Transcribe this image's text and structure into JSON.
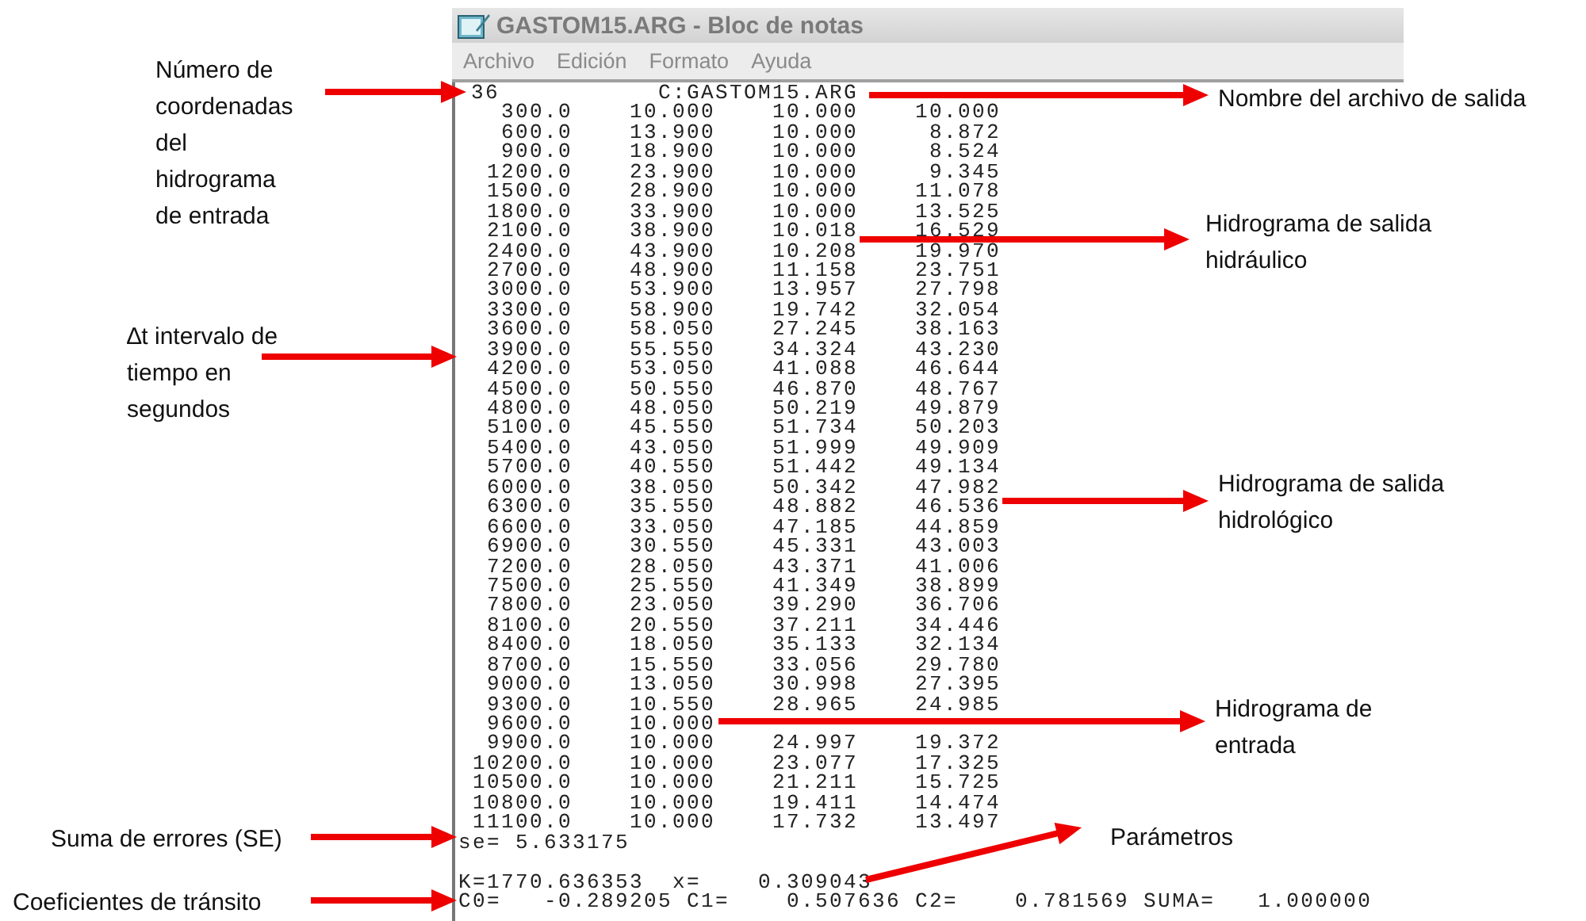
{
  "window": {
    "title": "GASTOM15.ARG - Bloc de notas"
  },
  "menu": [
    "Archivo",
    "Edición",
    "Formato",
    "Ayuda"
  ],
  "document": {
    "header": [
      "36",
      "C:GASTOM15.ARG"
    ],
    "rows": [
      [
        "300.0",
        "10.000",
        "10.000",
        "10.000"
      ],
      [
        "600.0",
        "13.900",
        "10.000",
        "8.872"
      ],
      [
        "900.0",
        "18.900",
        "10.000",
        "8.524"
      ],
      [
        "1200.0",
        "23.900",
        "10.000",
        "9.345"
      ],
      [
        "1500.0",
        "28.900",
        "10.000",
        "11.078"
      ],
      [
        "1800.0",
        "33.900",
        "10.000",
        "13.525"
      ],
      [
        "2100.0",
        "38.900",
        "10.018",
        "16.529"
      ],
      [
        "2400.0",
        "43.900",
        "10.208",
        "19.970"
      ],
      [
        "2700.0",
        "48.900",
        "11.158",
        "23.751"
      ],
      [
        "3000.0",
        "53.900",
        "13.957",
        "27.798"
      ],
      [
        "3300.0",
        "58.900",
        "19.742",
        "32.054"
      ],
      [
        "3600.0",
        "58.050",
        "27.245",
        "38.163"
      ],
      [
        "3900.0",
        "55.550",
        "34.324",
        "43.230"
      ],
      [
        "4200.0",
        "53.050",
        "41.088",
        "46.644"
      ],
      [
        "4500.0",
        "50.550",
        "46.870",
        "48.767"
      ],
      [
        "4800.0",
        "48.050",
        "50.219",
        "49.879"
      ],
      [
        "5100.0",
        "45.550",
        "51.734",
        "50.203"
      ],
      [
        "5400.0",
        "43.050",
        "51.999",
        "49.909"
      ],
      [
        "5700.0",
        "40.550",
        "51.442",
        "49.134"
      ],
      [
        "6000.0",
        "38.050",
        "50.342",
        "47.982"
      ],
      [
        "6300.0",
        "35.550",
        "48.882",
        "46.536"
      ],
      [
        "6600.0",
        "33.050",
        "47.185",
        "44.859"
      ],
      [
        "6900.0",
        "30.550",
        "45.331",
        "43.003"
      ],
      [
        "7200.0",
        "28.050",
        "43.371",
        "41.006"
      ],
      [
        "7500.0",
        "25.550",
        "41.349",
        "38.899"
      ],
      [
        "7800.0",
        "23.050",
        "39.290",
        "36.706"
      ],
      [
        "8100.0",
        "20.550",
        "37.211",
        "34.446"
      ],
      [
        "8400.0",
        "18.050",
        "35.133",
        "32.134"
      ],
      [
        "8700.0",
        "15.550",
        "33.056",
        "29.780"
      ],
      [
        "9000.0",
        "13.050",
        "30.998",
        "27.395"
      ],
      [
        "9300.0",
        "10.550",
        "28.965",
        "24.985"
      ],
      [
        "9600.0",
        "10.000"
      ],
      [
        "9900.0",
        "10.000",
        "24.997",
        "19.372"
      ],
      [
        "10200.0",
        "10.000",
        "23.077",
        "17.325"
      ],
      [
        "10500.0",
        "10.000",
        "21.211",
        "15.725"
      ],
      [
        "10800.0",
        "10.000",
        "19.411",
        "14.474"
      ],
      [
        "11100.0",
        "10.000",
        "17.732",
        "13.497"
      ]
    ],
    "error_line": "se= 5.633175",
    "parameters_line": "K=1770.636353  x=    0.309043",
    "coefficients_line": "C0=   -0.289205 C1=    0.507636 C2=    0.781569 SUMA=   1.000000"
  },
  "annotations": [
    {
      "text": "Número de\ncoordenadas\ndel\nhidrograma\nde entrada"
    },
    {
      "text": "Nombre del archivo de salida"
    },
    {
      "text": "Hidrograma de salida\nhidráulico"
    },
    {
      "text": "∆t intervalo de\ntiempo en\nsegundos"
    },
    {
      "text": "Hidrograma de salida\nhidrológico"
    },
    {
      "text": "Hidrograma de\nentrada"
    },
    {
      "text": "Suma de errores  (SE)"
    },
    {
      "text": "Parámetros"
    },
    {
      "text": "Coeficientes de tránsito"
    }
  ]
}
